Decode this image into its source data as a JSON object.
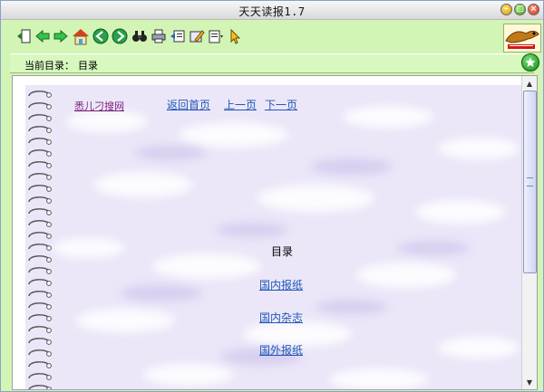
{
  "window": {
    "title": "天天读报1.7"
  },
  "toolbar": {
    "tools": [
      {
        "name": "exit-icon"
      },
      {
        "name": "back-icon"
      },
      {
        "name": "forward-icon"
      },
      {
        "name": "home-icon"
      },
      {
        "name": "prev-circle-icon"
      },
      {
        "name": "next-circle-icon"
      },
      {
        "name": "search-binoculars-icon"
      },
      {
        "name": "print-icon"
      },
      {
        "name": "import-icon"
      },
      {
        "name": "edit-icon"
      },
      {
        "name": "settings-icon"
      },
      {
        "name": "pointer-icon"
      }
    ]
  },
  "location": {
    "label": "当前目录：",
    "value": "目录"
  },
  "page": {
    "brand": "悉儿刁搜网",
    "nav": {
      "home": "返回首页",
      "prev": "上一页",
      "next": "下一页"
    },
    "heading": "目录",
    "links": [
      "国内报纸",
      "国内杂志",
      "国外报纸"
    ]
  },
  "colors": {
    "toolbar_bg": "#d2f5b6",
    "link": "#2058b8",
    "brand_link": "#7a1e7a",
    "page_bg": "#ebe6f8"
  }
}
